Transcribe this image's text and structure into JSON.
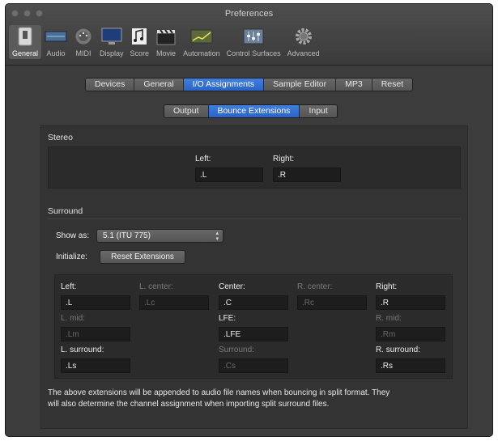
{
  "window": {
    "title": "Preferences"
  },
  "toolbar": {
    "items": [
      {
        "label": "General",
        "icon": "general-switch-icon"
      },
      {
        "label": "Audio",
        "icon": "audio-interface-icon"
      },
      {
        "label": "MIDI",
        "icon": "midi-connector-icon"
      },
      {
        "label": "Display",
        "icon": "display-monitor-icon"
      },
      {
        "label": "Score",
        "icon": "score-notes-icon"
      },
      {
        "label": "Movie",
        "icon": "movie-clapper-icon"
      },
      {
        "label": "Automation",
        "icon": "automation-curve-icon"
      },
      {
        "label": "Control Surfaces",
        "icon": "control-surface-icon"
      },
      {
        "label": "Advanced",
        "icon": "advanced-gear-icon"
      }
    ]
  },
  "main_tabs": [
    "Devices",
    "General",
    "I/O Assignments",
    "Sample Editor",
    "MP3",
    "Reset"
  ],
  "sub_tabs": [
    "Output",
    "Bounce Extensions",
    "Input"
  ],
  "stereo": {
    "title": "Stereo",
    "left_label": "Left:",
    "left_value": ".L",
    "right_label": "Right:",
    "right_value": ".R"
  },
  "surround": {
    "title": "Surround",
    "show_as_label": "Show as:",
    "show_as_value": "5.1 (ITU 775)",
    "initialize_label": "Initialize:",
    "reset_button": "Reset Extensions",
    "channels": {
      "left": {
        "label": "Left:",
        "value": ".L"
      },
      "l_center": {
        "label": "L. center:",
        "value": ".Lc"
      },
      "center": {
        "label": "Center:",
        "value": ".C"
      },
      "r_center": {
        "label": "R. center:",
        "value": ".Rc"
      },
      "right": {
        "label": "Right:",
        "value": ".R"
      },
      "l_mid": {
        "label": "L. mid:",
        "value": ".Lm"
      },
      "lfe": {
        "label": "LFE:",
        "value": ".LFE"
      },
      "r_mid": {
        "label": "R. mid:",
        "value": ".Rm"
      },
      "l_surround": {
        "label": "L. surround:",
        "value": ".Ls"
      },
      "surround": {
        "label": "Surround:",
        "value": ".Cs"
      },
      "r_surround": {
        "label": "R. surround:",
        "value": ".Rs"
      }
    },
    "note_line1": "The above extensions will be appended to audio file names when bouncing in split format. They",
    "note_line2": "will also determine the channel assignment when importing split surround files."
  }
}
